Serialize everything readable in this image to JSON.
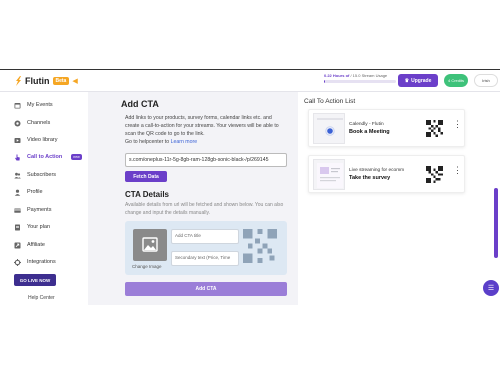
{
  "header": {
    "brand": "Flutin",
    "brand_badge": "Beta",
    "usage_text_highlight": "0.22 Hours of",
    "usage_text_rest": " / 15.0 Stream Usage",
    "usage_fraction": 0.015,
    "upgrade_label": "Upgrade",
    "credits_label": "4 Credits",
    "user_label": "Irish"
  },
  "sidebar": {
    "items": [
      {
        "label": "My Events",
        "icon": "calendar-icon"
      },
      {
        "label": "Channels",
        "icon": "channels-icon"
      },
      {
        "label": "Video library",
        "icon": "video-library-icon"
      },
      {
        "label": "Call to Action",
        "icon": "hand-pointer-icon",
        "badge": "new"
      },
      {
        "label": "Subscribers",
        "icon": "subscribers-icon"
      },
      {
        "label": "Profile",
        "icon": "profile-icon"
      },
      {
        "label": "Payments",
        "icon": "payments-icon"
      },
      {
        "label": "Your plan",
        "icon": "plan-icon"
      },
      {
        "label": "Affiliate",
        "icon": "affiliate-icon"
      },
      {
        "label": "Integrations",
        "icon": "integrations-icon"
      }
    ],
    "go_live": "GO LIVE NOW",
    "help_center": "Help Center"
  },
  "main": {
    "title": "Add CTA",
    "description": "Add links to your products, survey forms, calendar links etc. and create a call-to-action for your streams. Your viewers will be able to scan the QR code to go to the link.",
    "help_prefix": "Go to helpcenter to ",
    "help_link": "Learn more",
    "url_value": "s.com/oneplus-11r-5g-8gb-ram-128gb-sonic-black-/p/269145",
    "fetch_label": "Fetch Data",
    "details_title": "CTA Details",
    "details_desc": "Available details from url will be fetched and shown below. You can also change and input the details manually.",
    "change_image": "Change Image",
    "cta_title_placeholder": "Add CTA title",
    "cta_secondary_placeholder": "Secondary text (Price, Time",
    "add_label": "Add CTA"
  },
  "right": {
    "list_title": "Call To Action List",
    "cards": [
      {
        "subtitle": "Calendly - Flutin",
        "title": "Book a Meeting"
      },
      {
        "subtitle": "Live streaming for ecomm",
        "title": "Take the survey"
      }
    ]
  },
  "colors": {
    "accent": "#6b3fc9",
    "go_live": "#3d2e8f",
    "credits": "#3ec27a",
    "brand_badge": "#f5a623"
  }
}
